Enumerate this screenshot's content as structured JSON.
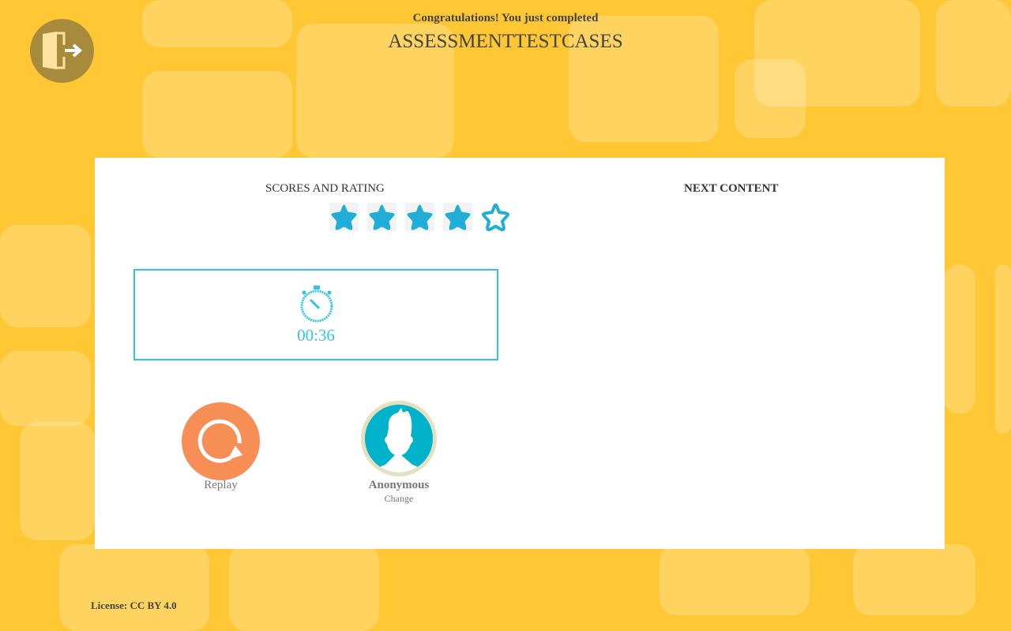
{
  "header": {
    "congrats": "Congratulations! You just completed",
    "title": "ASSESSMENTTESTCASES"
  },
  "exit_icon": "door-exit-icon",
  "scores": {
    "title": "SCORES AND RATING",
    "rating": 4,
    "max_rating": 5,
    "star_color": "#1eaed6"
  },
  "timer": {
    "icon": "stopwatch-icon",
    "value": "00:36",
    "color": "#33c4e3"
  },
  "replay": {
    "label": "Replay",
    "icon": "replay-icon",
    "color": "#f68e56"
  },
  "user": {
    "name": "Anonymous",
    "change_label": "Change",
    "icon": "avatar-icon"
  },
  "next_content": {
    "title": "NEXT CONTENT"
  },
  "footer": {
    "license": "License: CC BY 4.0"
  }
}
